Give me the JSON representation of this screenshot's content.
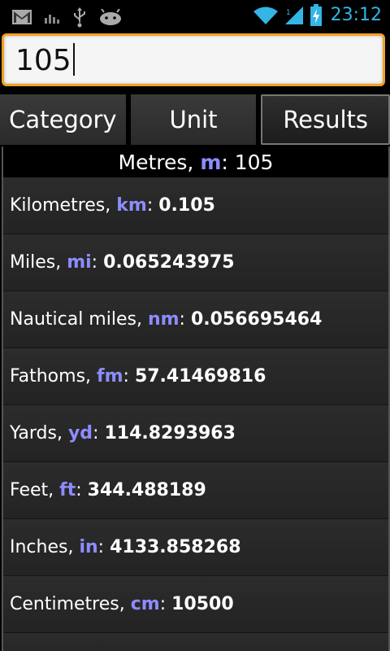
{
  "status_bar": {
    "left_icons": [
      "gmail-icon",
      "bar-chart-icon",
      "usb-icon",
      "android-icon"
    ],
    "right_icons": [
      "wifi-icon",
      "signal-icon",
      "battery-icon"
    ],
    "time": "23:12",
    "accent_color": "#33b5e5"
  },
  "input": {
    "value": "105"
  },
  "tabs": [
    {
      "label": "Category"
    },
    {
      "label": "Unit"
    },
    {
      "label": "Results",
      "active": true
    }
  ],
  "results": {
    "header": {
      "name": "Metres, ",
      "symbol": "m",
      "value": ": 105"
    },
    "rows": [
      {
        "name": "Kilometres, ",
        "symbol": "km",
        "value": "0.105"
      },
      {
        "name": "Miles, ",
        "symbol": "mi",
        "value": "0.065243975"
      },
      {
        "name": "Nautical miles, ",
        "symbol": "nm",
        "value": "0.056695464"
      },
      {
        "name": "Fathoms, ",
        "symbol": "fm",
        "value": "57.41469816"
      },
      {
        "name": "Yards, ",
        "symbol": "yd",
        "value": "114.8293963"
      },
      {
        "name": "Feet, ",
        "symbol": "ft",
        "value": "344.488189"
      },
      {
        "name": "Inches, ",
        "symbol": "in",
        "value": "4133.858268"
      },
      {
        "name": "Centimetres, ",
        "symbol": "cm",
        "value": "10500"
      }
    ]
  },
  "colors": {
    "input_border": "#f0a020",
    "unit_symbol": "#8c8cff"
  }
}
